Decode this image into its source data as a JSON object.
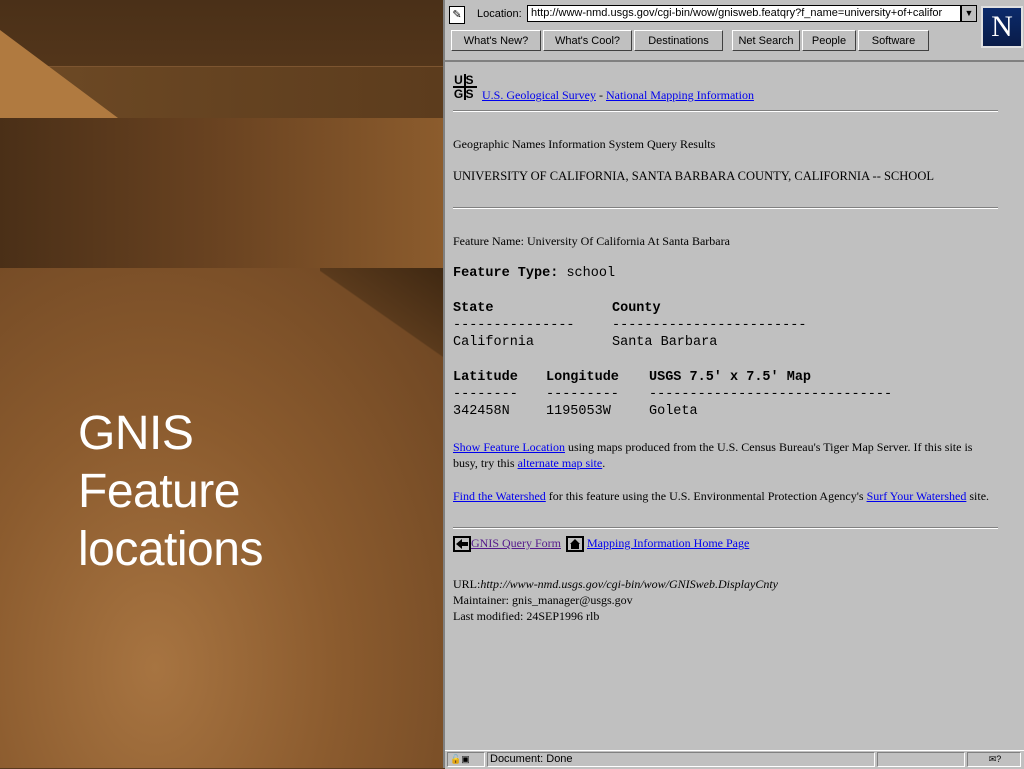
{
  "slide": {
    "title_lines": [
      "GNIS",
      "Feature",
      "locations"
    ]
  },
  "browser": {
    "location_label": "Location:",
    "location_url": "http://www-nmd.usgs.gov/cgi-bin/wow/gnisweb.featqry?f_name=university+of+califor",
    "logo_letter": "N",
    "directory_buttons": [
      "What's New?",
      "What's Cool?",
      "Destinations",
      "Net Search",
      "People",
      "Software"
    ],
    "status_text": "Document: Done"
  },
  "page": {
    "usgs_logo": [
      "U",
      "S",
      "G",
      "S"
    ],
    "usgs_link": "U.S. Geological Survey",
    "separator": "-",
    "nmi_link": "National Mapping Information",
    "results_heading": "Geographic Names Information System Query Results",
    "query_line": "UNIVERSITY OF CALIFORNIA, SANTA BARBARA COUNTY, CALIFORNIA -- SCHOOL",
    "feature_name_label": "Feature Name: ",
    "feature_name": "University Of California At Santa Barbara",
    "feature_type_label": "Feature Type:",
    "feature_type": "school",
    "state_header": "State",
    "county_header": "County",
    "state_rule": "---------------",
    "county_rule": "------------------------",
    "state": "California",
    "county": "Santa Barbara",
    "lat_header": "Latitude",
    "lon_header": "Longitude",
    "map_header": "USGS 7.5' x 7.5' Map",
    "lat_rule": "--------",
    "lon_rule": "---------",
    "map_rule": "------------------------------",
    "latitude": "342458N",
    "longitude": "1195053W",
    "map": "Goleta",
    "show_location_link": "Show Feature Location",
    "show_location_text": " using maps produced from the U.S. Census Bureau's Tiger Map Server. If this site is busy, try this ",
    "alt_map_link": "alternate map site",
    "alt_map_end": ".",
    "watershed_link": "Find the Watershed",
    "watershed_text": " for this feature using the U.S. Environmental Protection Agency's ",
    "surf_link": "Surf Your Watershed",
    "surf_end": " site.",
    "query_form_link": "GNIS Query Form",
    "home_link": "Mapping Information Home Page",
    "url_label": "URL:",
    "url_value": "http://www-nmd.usgs.gov/cgi-bin/wow/GNISweb.DisplayCnty",
    "maintainer": "Maintainer: gnis_manager@usgs.gov",
    "last_modified": "Last modified: 24SEP1996 rlb"
  }
}
